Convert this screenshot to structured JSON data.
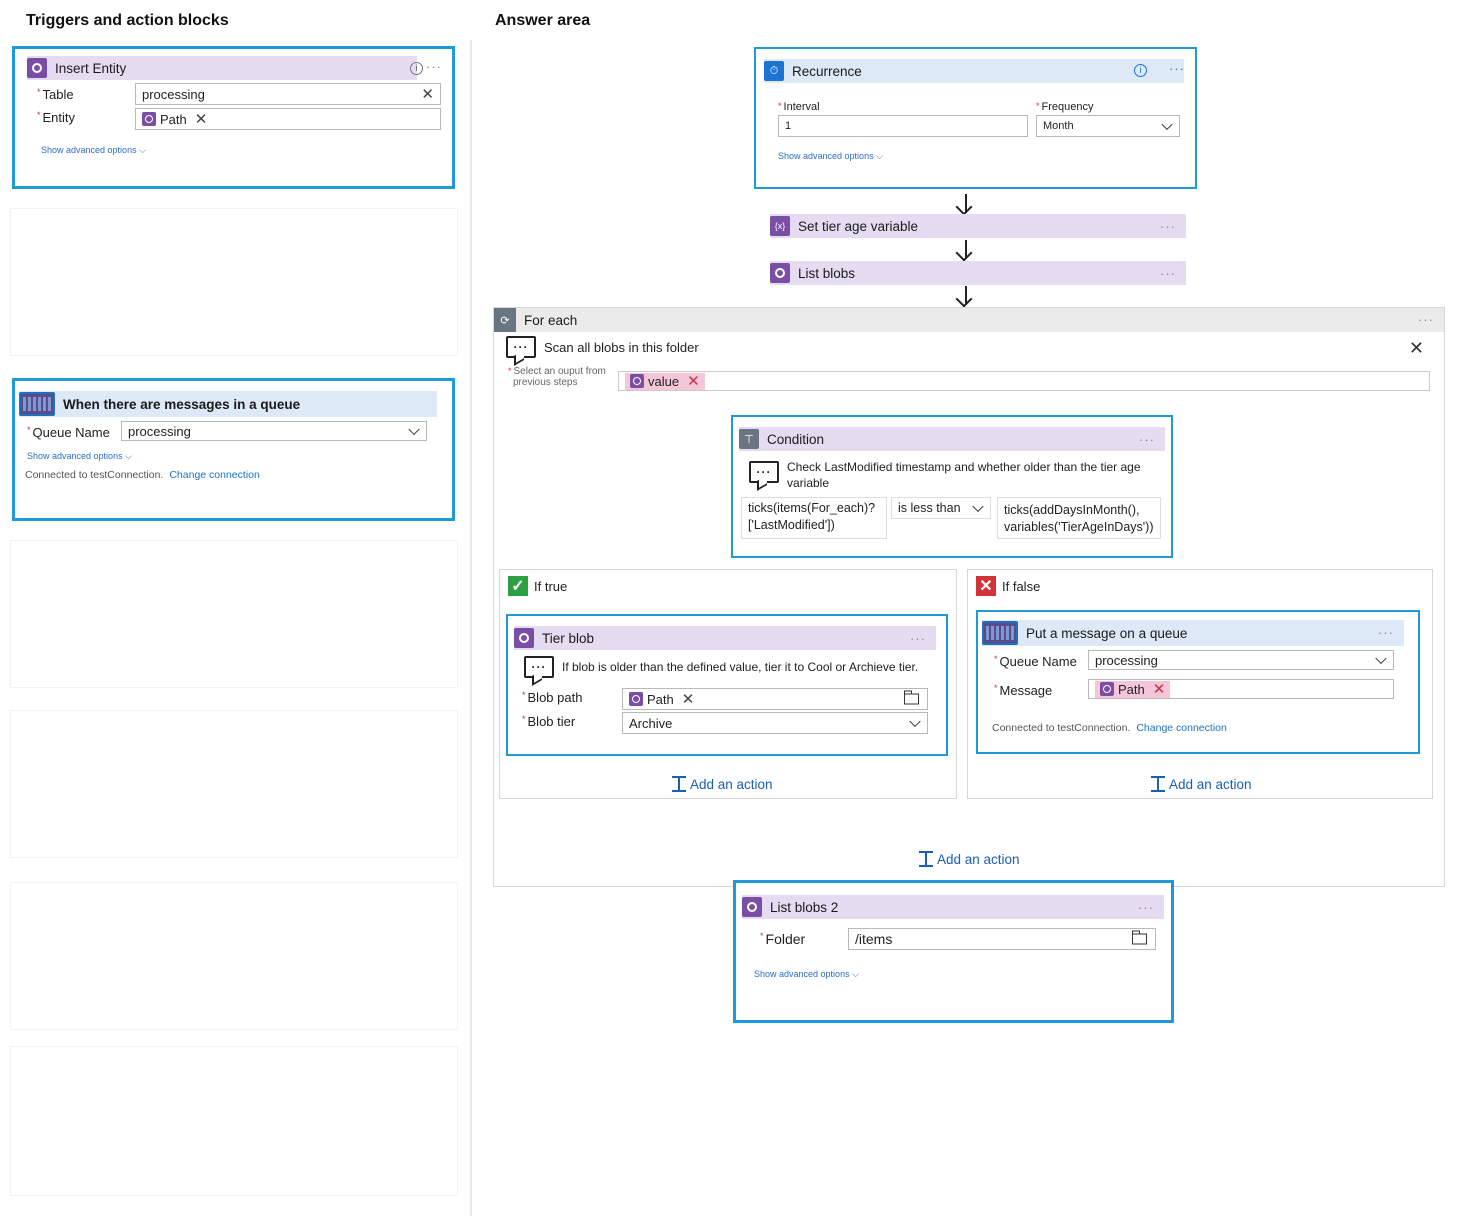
{
  "left_title": "Triggers and action blocks",
  "right_title": "Answer area",
  "insert_entity": {
    "title": "Insert Entity",
    "table_label": "Table",
    "table_value": "processing",
    "entity_label": "Entity",
    "entity_chip": "Path",
    "advanced": "Show advanced options"
  },
  "queue_trigger": {
    "title": "When there are messages in a queue",
    "queue_label": "Queue Name",
    "queue_value": "processing",
    "advanced": "Show advanced options",
    "connected": "Connected to testConnection.",
    "change": "Change connection"
  },
  "recurrence": {
    "title": "Recurrence",
    "interval_label": "Interval",
    "interval_value": "1",
    "frequency_label": "Frequency",
    "frequency_value": "Month",
    "advanced": "Show advanced options"
  },
  "set_tier": {
    "title": "Set tier age variable",
    "icon_text": "{x}"
  },
  "list_blobs": {
    "title": "List blobs"
  },
  "for_each": {
    "title": "For each",
    "comment": "Scan all blobs in this folder",
    "select_label_1": "Select an ouput from",
    "select_label_2": "previous steps",
    "chip": "value"
  },
  "condition": {
    "title": "Condition",
    "comment_1": "Check LastModified timestamp and whether older than the tier age",
    "comment_2": "variable",
    "left_1": "ticks(items(For_each)?",
    "left_2": "['LastModified'])",
    "operator": "is less than",
    "right_1": "ticks(addDaysInMonth(),",
    "right_2": "variables('TierAgeInDays'))"
  },
  "if_true": {
    "label": "If true",
    "tier_blob": {
      "title": "Tier blob",
      "comment": "If blob is older than the defined value, tier it to Cool or Archieve tier.",
      "blob_path_label": "Blob path",
      "blob_path_chip": "Path",
      "blob_tier_label": "Blob tier",
      "blob_tier_value": "Archive"
    },
    "add_action": "Add an action"
  },
  "if_false": {
    "label": "If false",
    "put_message": {
      "title": "Put a message on a queue",
      "queue_label": "Queue Name",
      "queue_value": "processing",
      "message_label": "Message",
      "message_chip": "Path",
      "connected": "Connected to testConnection.",
      "change": "Change connection"
    },
    "add_action": "Add an action"
  },
  "foreach_add_action": "Add an action",
  "list_blobs_2": {
    "title": "List blobs 2",
    "folder_label": "Folder",
    "folder_value": "/items",
    "advanced": "Show advanced options"
  },
  "colors": {
    "accent_border": "#1e9ad6",
    "header_purple": "#e6dcf1",
    "header_blue": "#dde9f7",
    "chip_pink": "#f5c6d8",
    "link": "#1a73c6"
  }
}
